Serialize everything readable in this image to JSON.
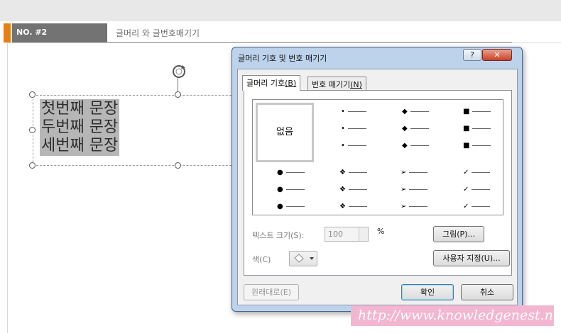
{
  "slide": {
    "number_label": "NO. #2",
    "title": "글머리 와 글번호매기기",
    "lines": [
      "첫번째 문장",
      "두번째 문장",
      "세번째 문장"
    ]
  },
  "dialog": {
    "title": "글머리 기호 및 번호 매기기",
    "help_label": "?",
    "close_label": "✕",
    "tabs": [
      {
        "label": "글머리 기호",
        "mnemonic": "(B)",
        "active": true
      },
      {
        "label": "번호 매기기",
        "mnemonic": "(N)",
        "active": false
      }
    ],
    "none_label": "없음",
    "bullet_styles": [
      "•",
      "◆",
      "■",
      "●",
      "❖",
      "➢",
      "✓"
    ],
    "size_label": "텍스트 크기(S):",
    "size_value": "100",
    "size_unit": "%",
    "color_label": "색(C)",
    "picture_button": "그림(P)...",
    "custom_button": "사용자 지정(U)...",
    "reset_button": "원래대로(E)",
    "ok_button": "확인",
    "cancel_button": "취소"
  },
  "watermark": "http://www.knowledgenest.net",
  "colors": {
    "accent_orange": "#e97d15",
    "header_gray": "#737373",
    "dialog_frame": "#bdd3ec",
    "selection_gray": "#b6b6b6",
    "watermark_pink": "#f3b6d0"
  }
}
